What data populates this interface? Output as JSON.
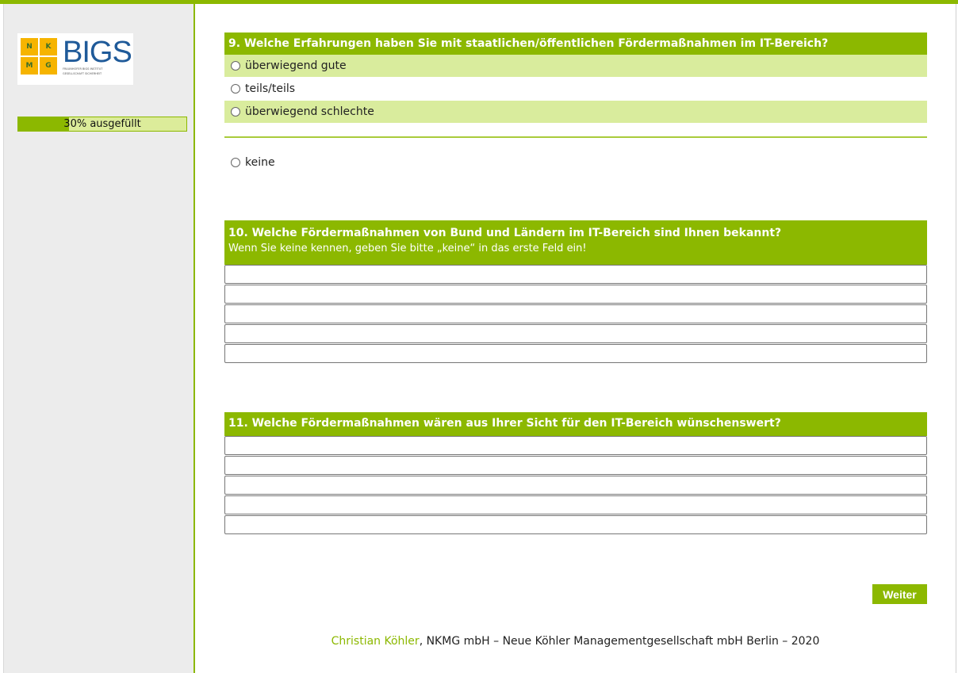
{
  "logo": {
    "cells": [
      "N",
      "K",
      "M",
      "G"
    ],
    "word": "BIGS",
    "tagline": [
      "FRAUNHOFER BIGS INSTITUT",
      "GESELLSCHAFT SICHERHEIT"
    ]
  },
  "progress": {
    "label": "30% ausgefüllt",
    "fraction": 0.3
  },
  "q9": {
    "title": "9. Welche Erfahrungen haben Sie mit staatlichen/öffentlichen Fördermaßnahmen im IT-Bereich?",
    "options": [
      "überwiegend gute",
      "teils/teils",
      "überwiegend schlechte"
    ],
    "extra_option": "keine"
  },
  "q10": {
    "title": "10. Welche Fördermaßnahmen von Bund und Ländern im IT-Bereich sind Ihnen bekannt?",
    "hint": "Wenn Sie keine kennen, geben Sie bitte „keine“ in das erste Feld ein!",
    "fields": [
      "",
      "",
      "",
      "",
      ""
    ]
  },
  "q11": {
    "title": "11. Welche Fördermaßnahmen wären aus Ihrer Sicht für den IT-Bereich wünschenswert?",
    "fields": [
      "",
      "",
      "",
      "",
      ""
    ]
  },
  "actions": {
    "next_label": "Weiter"
  },
  "footer": {
    "author": "Christian Köhler",
    "rest": ", NKMG mbH – Neue Köhler Managementgesellschaft mbH Berlin – 2020"
  },
  "colors": {
    "accent": "#8cb800",
    "accent_light": "#d9ec9d",
    "sidebar_bg": "#ececec",
    "brand_blue": "#1f5a99",
    "logo_yellow": "#f6b400"
  }
}
